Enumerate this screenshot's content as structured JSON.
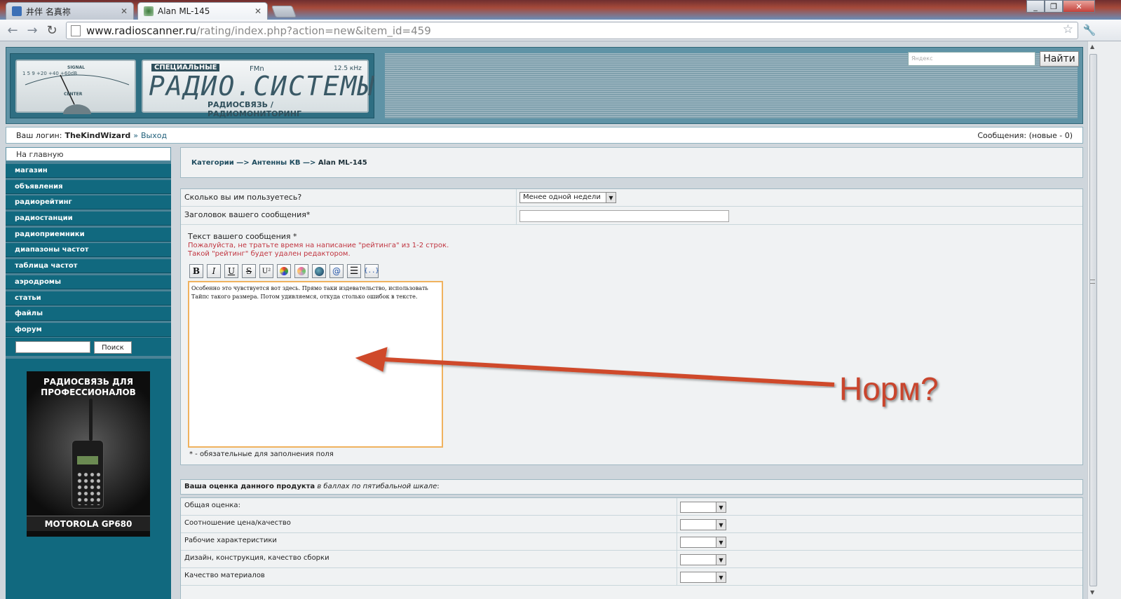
{
  "browser": {
    "tabs": [
      {
        "title": "井伴 名真祢",
        "active": false
      },
      {
        "title": "Alan ML-145",
        "active": true
      }
    ],
    "url_host": "www.radioscanner.ru",
    "url_path": "/rating/index.php?action=new&item_id=459"
  },
  "header": {
    "meter_label": "SIGNAL",
    "meter_scale": "1   5   9  +20  +40  +60dB",
    "meter_center": "CENTER",
    "brand_small": "СПЕЦИАЛЬНЫЕ",
    "brand_fm": "FMn",
    "brand_khz": "12.5 кHz",
    "brand_big": "РАДИО.СИСТЕМЫ",
    "brand_sub": "РАДИОСВЯЗЬ / РАДИОМОНИТОРИНГ",
    "search_placeholder": "Яндекс",
    "search_button": "Найти"
  },
  "login": {
    "prefix": "Ваш логин:",
    "username": "TheKindWizard",
    "sep": "»",
    "logout": "Выход",
    "messages": "Сообщения: (новые - 0)"
  },
  "sidebar": {
    "home": "На главную",
    "items": [
      "магазин",
      "объявления",
      "радиорейтинг",
      "радиостанции",
      "радиоприемники",
      "диапазоны частот",
      "таблица частот",
      "аэродромы",
      "статьи",
      "файлы",
      "форум"
    ],
    "search_button": "Поиск",
    "ad_title": "РАДИОСВЯЗЬ ДЛЯ ПРОФЕССИОНАЛОВ",
    "ad_footer": "MOTOROLA GP680"
  },
  "breadcrumb": {
    "cat": "Категории",
    "arrow": " —> ",
    "sub": "Антенны КВ",
    "current": "Alan ML-145"
  },
  "form": {
    "usage_label": "Сколько вы им пользуетесь?",
    "usage_value": "Менее одной недели",
    "title_label": "Заголовок вашего сообщения*",
    "message_label": "Текст вашего сообщения *",
    "warning_line1": "Пожалуйста, не тратьте время на написание \"рейтинга\" из 1-2 строк.",
    "warning_line2": "Такой \"рейтинг\" будет удален редактором.",
    "editor_text": "Особенно это чувствуется вот здесь. Прямо таки издевательство, использовать Тайпс такого размера. Потом удивляемся, откуда столько ошибок в тексте.",
    "required_note": "* - обязательные для заполнения поля",
    "toolbar": [
      "B",
      "I",
      "U",
      "S",
      "U²",
      "color",
      "color2",
      "web",
      "@",
      "list",
      "{..}"
    ]
  },
  "rating": {
    "heading_bold": "Ваша оценка данного продукта",
    "heading_italic": "в баллах по пятибальной шкале",
    "heading_colon": ":",
    "rows": [
      "Общая оценка:",
      "Соотношение цена/качество",
      "Рабочие характеристики",
      "Дизайн, конструкция, качество сборки",
      "Качество материалов"
    ]
  },
  "annotation": {
    "text": "Норм?",
    "color": "#c9452d"
  }
}
